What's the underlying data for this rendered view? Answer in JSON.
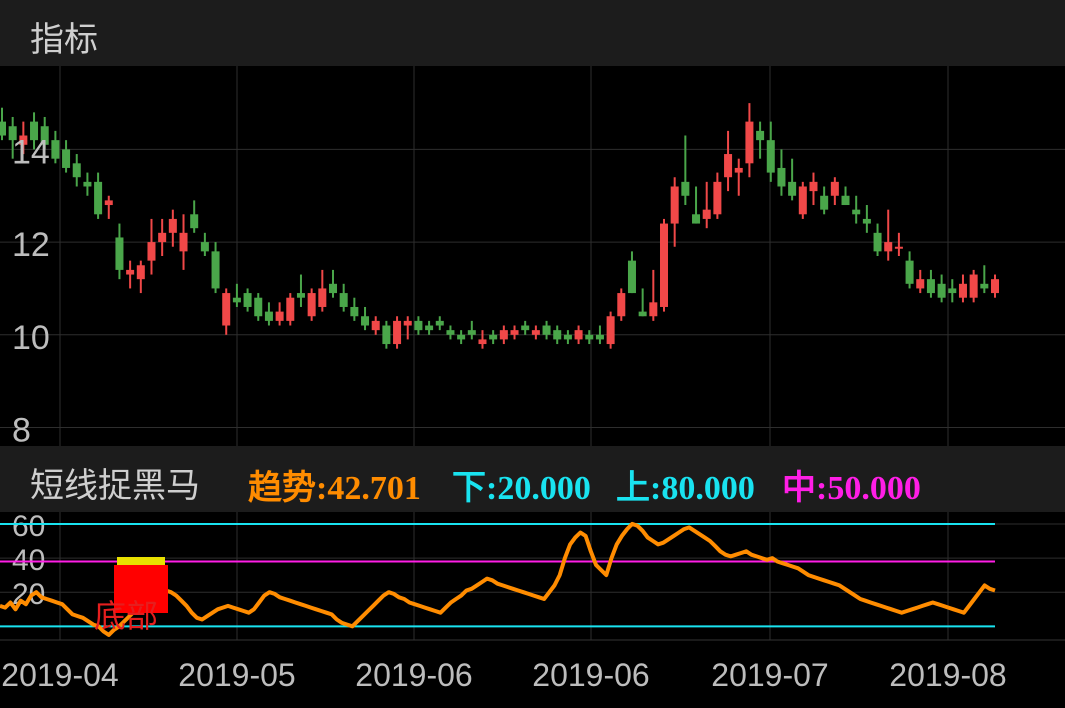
{
  "header": {
    "title": "指标"
  },
  "indicator": {
    "name": "短线捉黑马",
    "trend_label": "趋势:42.701",
    "low_label": "下:20.000",
    "high_label": "上:80.000",
    "mid_label": "中:50.000",
    "colors": {
      "trend": "#ff8c00",
      "low": "#19e3f0",
      "high": "#19e3f0",
      "mid": "#ff1ee6"
    }
  },
  "chart_data": [
    {
      "type": "candlestick",
      "y_ticks": [
        14,
        12,
        10,
        8
      ],
      "ylim": [
        7.6,
        15.8
      ],
      "colors": {
        "up": "#f04848",
        "down": "#4aa64a",
        "grid": "#2e2e2e"
      },
      "ohlc": [
        [
          14.6,
          14.9,
          14.2,
          14.3
        ],
        [
          14.5,
          14.7,
          13.8,
          14.2
        ],
        [
          14.1,
          14.6,
          13.9,
          14.3
        ],
        [
          14.6,
          14.8,
          14.0,
          14.2
        ],
        [
          14.5,
          14.7,
          14.0,
          14.1
        ],
        [
          14.2,
          14.4,
          13.7,
          13.8
        ],
        [
          14.0,
          14.2,
          13.5,
          13.6
        ],
        [
          13.7,
          13.9,
          13.2,
          13.4
        ],
        [
          13.3,
          13.5,
          13.0,
          13.2
        ],
        [
          13.3,
          13.5,
          12.5,
          12.6
        ],
        [
          12.8,
          13.0,
          12.5,
          12.9
        ],
        [
          12.1,
          12.4,
          11.2,
          11.4
        ],
        [
          11.3,
          11.6,
          11.0,
          11.4
        ],
        [
          11.2,
          11.6,
          10.9,
          11.5
        ],
        [
          11.6,
          12.5,
          11.3,
          12.0
        ],
        [
          12.0,
          12.5,
          11.7,
          12.2
        ],
        [
          12.2,
          12.7,
          11.9,
          12.5
        ],
        [
          11.8,
          12.6,
          11.4,
          12.2
        ],
        [
          12.6,
          12.9,
          12.2,
          12.3
        ],
        [
          12.0,
          12.2,
          11.7,
          11.8
        ],
        [
          11.8,
          12.0,
          10.9,
          11.0
        ],
        [
          10.2,
          11.0,
          10.0,
          10.9
        ],
        [
          10.8,
          11.1,
          10.6,
          10.7
        ],
        [
          10.9,
          11.0,
          10.5,
          10.6
        ],
        [
          10.8,
          10.9,
          10.3,
          10.4
        ],
        [
          10.5,
          10.7,
          10.2,
          10.3
        ],
        [
          10.3,
          10.7,
          10.2,
          10.5
        ],
        [
          10.3,
          10.9,
          10.2,
          10.8
        ],
        [
          10.9,
          11.3,
          10.6,
          10.8
        ],
        [
          10.4,
          11.0,
          10.3,
          10.9
        ],
        [
          10.6,
          11.4,
          10.5,
          11.0
        ],
        [
          11.1,
          11.4,
          10.8,
          10.9
        ],
        [
          10.9,
          11.1,
          10.5,
          10.6
        ],
        [
          10.6,
          10.8,
          10.3,
          10.4
        ],
        [
          10.4,
          10.6,
          10.1,
          10.2
        ],
        [
          10.1,
          10.4,
          10.0,
          10.3
        ],
        [
          10.2,
          10.3,
          9.7,
          9.8
        ],
        [
          9.8,
          10.4,
          9.7,
          10.3
        ],
        [
          10.2,
          10.4,
          9.9,
          10.3
        ],
        [
          10.3,
          10.4,
          10.0,
          10.1
        ],
        [
          10.2,
          10.3,
          10.0,
          10.1
        ],
        [
          10.3,
          10.4,
          10.1,
          10.2
        ],
        [
          10.1,
          10.2,
          9.9,
          10.0
        ],
        [
          10.0,
          10.1,
          9.8,
          9.9
        ],
        [
          10.1,
          10.3,
          9.9,
          10.0
        ],
        [
          9.8,
          10.1,
          9.7,
          9.9
        ],
        [
          10.0,
          10.1,
          9.8,
          9.9
        ],
        [
          9.9,
          10.2,
          9.8,
          10.1
        ],
        [
          10.0,
          10.2,
          9.9,
          10.1
        ],
        [
          10.2,
          10.3,
          10.0,
          10.1
        ],
        [
          10.0,
          10.2,
          9.9,
          10.1
        ],
        [
          10.2,
          10.3,
          9.9,
          10.0
        ],
        [
          10.1,
          10.2,
          9.8,
          9.9
        ],
        [
          10.0,
          10.1,
          9.8,
          9.9
        ],
        [
          9.9,
          10.2,
          9.8,
          10.1
        ],
        [
          10.0,
          10.1,
          9.8,
          9.9
        ],
        [
          10.0,
          10.2,
          9.8,
          9.9
        ],
        [
          9.8,
          10.5,
          9.7,
          10.4
        ],
        [
          10.4,
          11.0,
          10.3,
          10.9
        ],
        [
          11.6,
          11.8,
          10.9,
          10.9
        ],
        [
          10.5,
          11.0,
          10.4,
          10.4
        ],
        [
          10.4,
          11.4,
          10.3,
          10.7
        ],
        [
          10.6,
          12.5,
          10.5,
          12.4
        ],
        [
          12.4,
          13.4,
          11.9,
          13.2
        ],
        [
          13.3,
          14.3,
          12.8,
          13.0
        ],
        [
          12.6,
          13.2,
          12.4,
          12.4
        ],
        [
          12.5,
          13.3,
          12.3,
          12.7
        ],
        [
          12.6,
          13.5,
          12.5,
          13.3
        ],
        [
          13.4,
          14.4,
          13.1,
          13.9
        ],
        [
          13.5,
          13.8,
          13.0,
          13.6
        ],
        [
          13.7,
          15.0,
          13.4,
          14.6
        ],
        [
          14.4,
          14.6,
          13.8,
          14.2
        ],
        [
          14.2,
          14.6,
          13.3,
          13.5
        ],
        [
          13.6,
          14.0,
          13.0,
          13.2
        ],
        [
          13.3,
          13.8,
          12.9,
          13.0
        ],
        [
          12.6,
          13.3,
          12.5,
          13.2
        ],
        [
          13.1,
          13.5,
          12.8,
          13.3
        ],
        [
          13.0,
          13.2,
          12.6,
          12.7
        ],
        [
          13.0,
          13.4,
          12.8,
          13.3
        ],
        [
          13.0,
          13.2,
          12.8,
          12.8
        ],
        [
          12.7,
          13.0,
          12.4,
          12.6
        ],
        [
          12.5,
          12.8,
          12.2,
          12.4
        ],
        [
          12.2,
          12.4,
          11.7,
          11.8
        ],
        [
          11.8,
          12.7,
          11.6,
          12.0
        ],
        [
          11.9,
          12.2,
          11.7,
          11.9
        ],
        [
          11.6,
          11.8,
          11.0,
          11.1
        ],
        [
          11.0,
          11.4,
          10.9,
          11.2
        ],
        [
          11.2,
          11.4,
          10.8,
          10.9
        ],
        [
          11.1,
          11.3,
          10.7,
          10.8
        ],
        [
          11.0,
          11.2,
          10.7,
          10.9
        ],
        [
          10.8,
          11.3,
          10.7,
          11.1
        ],
        [
          10.8,
          11.4,
          10.7,
          11.3
        ],
        [
          11.1,
          11.5,
          10.9,
          11.0
        ],
        [
          10.9,
          11.3,
          10.8,
          11.2
        ]
      ]
    },
    {
      "type": "line",
      "y_ticks": [
        60,
        40,
        20
      ],
      "ylim": [
        -8,
        67
      ],
      "reference_lines": [
        {
          "name": "上",
          "value": 60,
          "color": "#19e3f0"
        },
        {
          "name": "中",
          "value": 38,
          "color": "#ff1ee6"
        },
        {
          "name": "下",
          "value": 0,
          "color": "#19e3f0"
        }
      ],
      "series": [
        {
          "name": "趋势",
          "color": "#ff8c00",
          "values": [
            12,
            11,
            14,
            10,
            15,
            13,
            18,
            20,
            17,
            16,
            15,
            14,
            13,
            10,
            7,
            6,
            5,
            3,
            1,
            0,
            -3,
            -5,
            -2,
            0,
            3,
            6,
            9,
            12,
            15,
            18,
            20,
            22,
            21,
            20,
            18,
            15,
            12,
            8,
            5,
            4,
            6,
            8,
            10,
            11,
            12,
            11,
            10,
            9,
            8,
            10,
            14,
            18,
            20,
            19,
            17,
            16,
            15,
            14,
            13,
            12,
            11,
            10,
            9,
            8,
            7,
            4,
            2,
            1,
            0,
            3,
            6,
            9,
            12,
            15,
            18,
            20,
            19,
            17,
            16,
            14,
            13,
            12,
            11,
            10,
            9,
            8,
            11,
            14,
            16,
            18,
            21,
            22,
            24,
            26,
            28,
            27,
            25,
            24,
            23,
            22,
            21,
            20,
            19,
            18,
            17,
            16,
            20,
            24,
            30,
            40,
            48,
            52,
            55,
            53,
            44,
            36,
            33,
            30,
            40,
            48,
            53,
            57,
            60,
            59,
            56,
            52,
            50,
            48,
            49,
            51,
            53,
            55,
            57,
            58,
            56,
            54,
            52,
            50,
            47,
            44,
            42,
            41,
            42,
            43,
            44,
            42,
            41,
            40,
            39,
            40,
            38,
            37,
            36,
            35,
            34,
            32,
            30,
            29,
            28,
            27,
            26,
            25,
            24,
            22,
            20,
            18,
            16,
            15,
            14,
            13,
            12,
            11,
            10,
            9,
            8,
            9,
            10,
            11,
            12,
            13,
            14,
            13,
            12,
            11,
            10,
            9,
            8,
            12,
            16,
            20,
            24,
            22,
            21
          ]
        }
      ],
      "annotation": {
        "text": "底部",
        "color": "#e61e1e"
      }
    }
  ],
  "x_axis": {
    "tick_labels": [
      "2019-04",
      "2019-05",
      "2019-06",
      "2019-06",
      "2019-07",
      "2019-08"
    ],
    "color": "#bdbdbd"
  }
}
